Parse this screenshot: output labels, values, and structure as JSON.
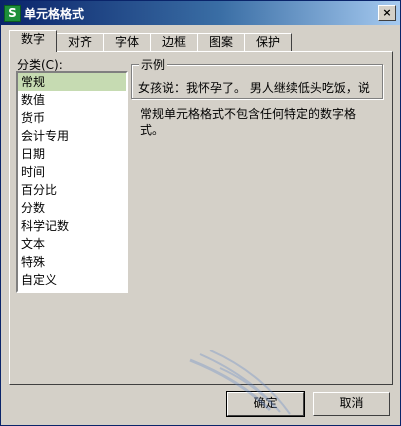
{
  "window": {
    "title": "单元格格式",
    "icon": "app-s-icon",
    "icon_letter": "S"
  },
  "tabs": [
    {
      "label": "数字"
    },
    {
      "label": "对齐"
    },
    {
      "label": "字体"
    },
    {
      "label": "边框"
    },
    {
      "label": "图案"
    },
    {
      "label": "保护"
    }
  ],
  "category": {
    "label": "分类(C):",
    "items": [
      "常规",
      "数值",
      "货币",
      "会计专用",
      "日期",
      "时间",
      "百分比",
      "分数",
      "科学记数",
      "文本",
      "特殊",
      "自定义"
    ]
  },
  "sample": {
    "legend": "示例",
    "text": "女孩说：我怀孕了。 男人继续低头吃饭，说"
  },
  "description": "常规单元格格式不包含任何特定的数字格式。",
  "buttons": {
    "ok": "确定",
    "cancel": "取消",
    "close": "×"
  },
  "colors": {
    "title_start": "#0a246a",
    "title_end": "#a6caf0",
    "selected": "#c6dbb2",
    "face": "#d4d0c8"
  }
}
